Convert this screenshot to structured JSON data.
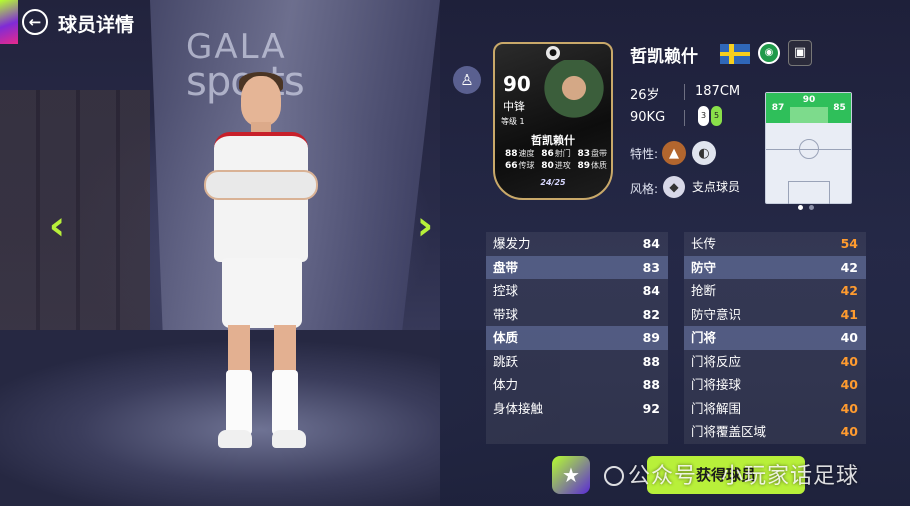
{
  "header": {
    "title": "球员详情"
  },
  "background": {
    "logo_line1": "GALA",
    "logo_line2": "sports"
  },
  "card": {
    "rating": "90",
    "position": "中锋",
    "level": "等级 1",
    "name": "哲凯赖什",
    "season": "24/25",
    "stats": [
      [
        {
          "v": "88",
          "l": "速度"
        },
        {
          "v": "86",
          "l": "射门"
        },
        {
          "v": "83",
          "l": "盘带"
        }
      ],
      [
        {
          "v": "66",
          "l": "传球"
        },
        {
          "v": "80",
          "l": "进攻"
        },
        {
          "v": "89",
          "l": "体质"
        }
      ]
    ]
  },
  "player": {
    "name": "哲凯赖什",
    "age": "26岁",
    "height": "187CM",
    "weight": "90KG",
    "foot_left": "3",
    "foot_right": "5",
    "traits_label": "特性:",
    "style_label": "风格:",
    "style_value": "支点球员"
  },
  "pitch": {
    "left": "87",
    "center": "90",
    "right": "85"
  },
  "attributes": {
    "left": [
      {
        "name": "爆发力",
        "value": "84",
        "group": false
      },
      {
        "name": "盘带",
        "value": "83",
        "group": true
      },
      {
        "name": "控球",
        "value": "84",
        "group": false
      },
      {
        "name": "带球",
        "value": "82",
        "group": false
      },
      {
        "name": "体质",
        "value": "89",
        "group": true
      },
      {
        "name": "跳跃",
        "value": "88",
        "group": false
      },
      {
        "name": "体力",
        "value": "88",
        "group": false
      },
      {
        "name": "身体接触",
        "value": "92",
        "group": false
      }
    ],
    "right": [
      {
        "name": "长传",
        "value": "54",
        "group": false
      },
      {
        "name": "防守",
        "value": "42",
        "group": true
      },
      {
        "name": "抢断",
        "value": "42",
        "group": false
      },
      {
        "name": "防守意识",
        "value": "41",
        "group": false
      },
      {
        "name": "门将",
        "value": "40",
        "group": true
      },
      {
        "name": "门将反应",
        "value": "40",
        "group": false
      },
      {
        "name": "门将接球",
        "value": "40",
        "group": false
      },
      {
        "name": "门将解围",
        "value": "40",
        "group": false
      },
      {
        "name": "门将覆盖区域",
        "value": "40",
        "group": false
      }
    ]
  },
  "buttons": {
    "get": "获得球员"
  },
  "watermark": "公众号 · 小玩家话足球",
  "colors": {
    "accent": "#b8f03a",
    "orange_value": "#ff9b2f",
    "pitch_green": "#2fbf5a"
  },
  "icons": [
    "back-arrow-icon",
    "left-arrow-icon",
    "right-arrow-icon",
    "coach-icon",
    "sweden-flag-icon",
    "club-crest-icon",
    "kit-icon",
    "trait-icon",
    "style-icon",
    "star-icon"
  ]
}
